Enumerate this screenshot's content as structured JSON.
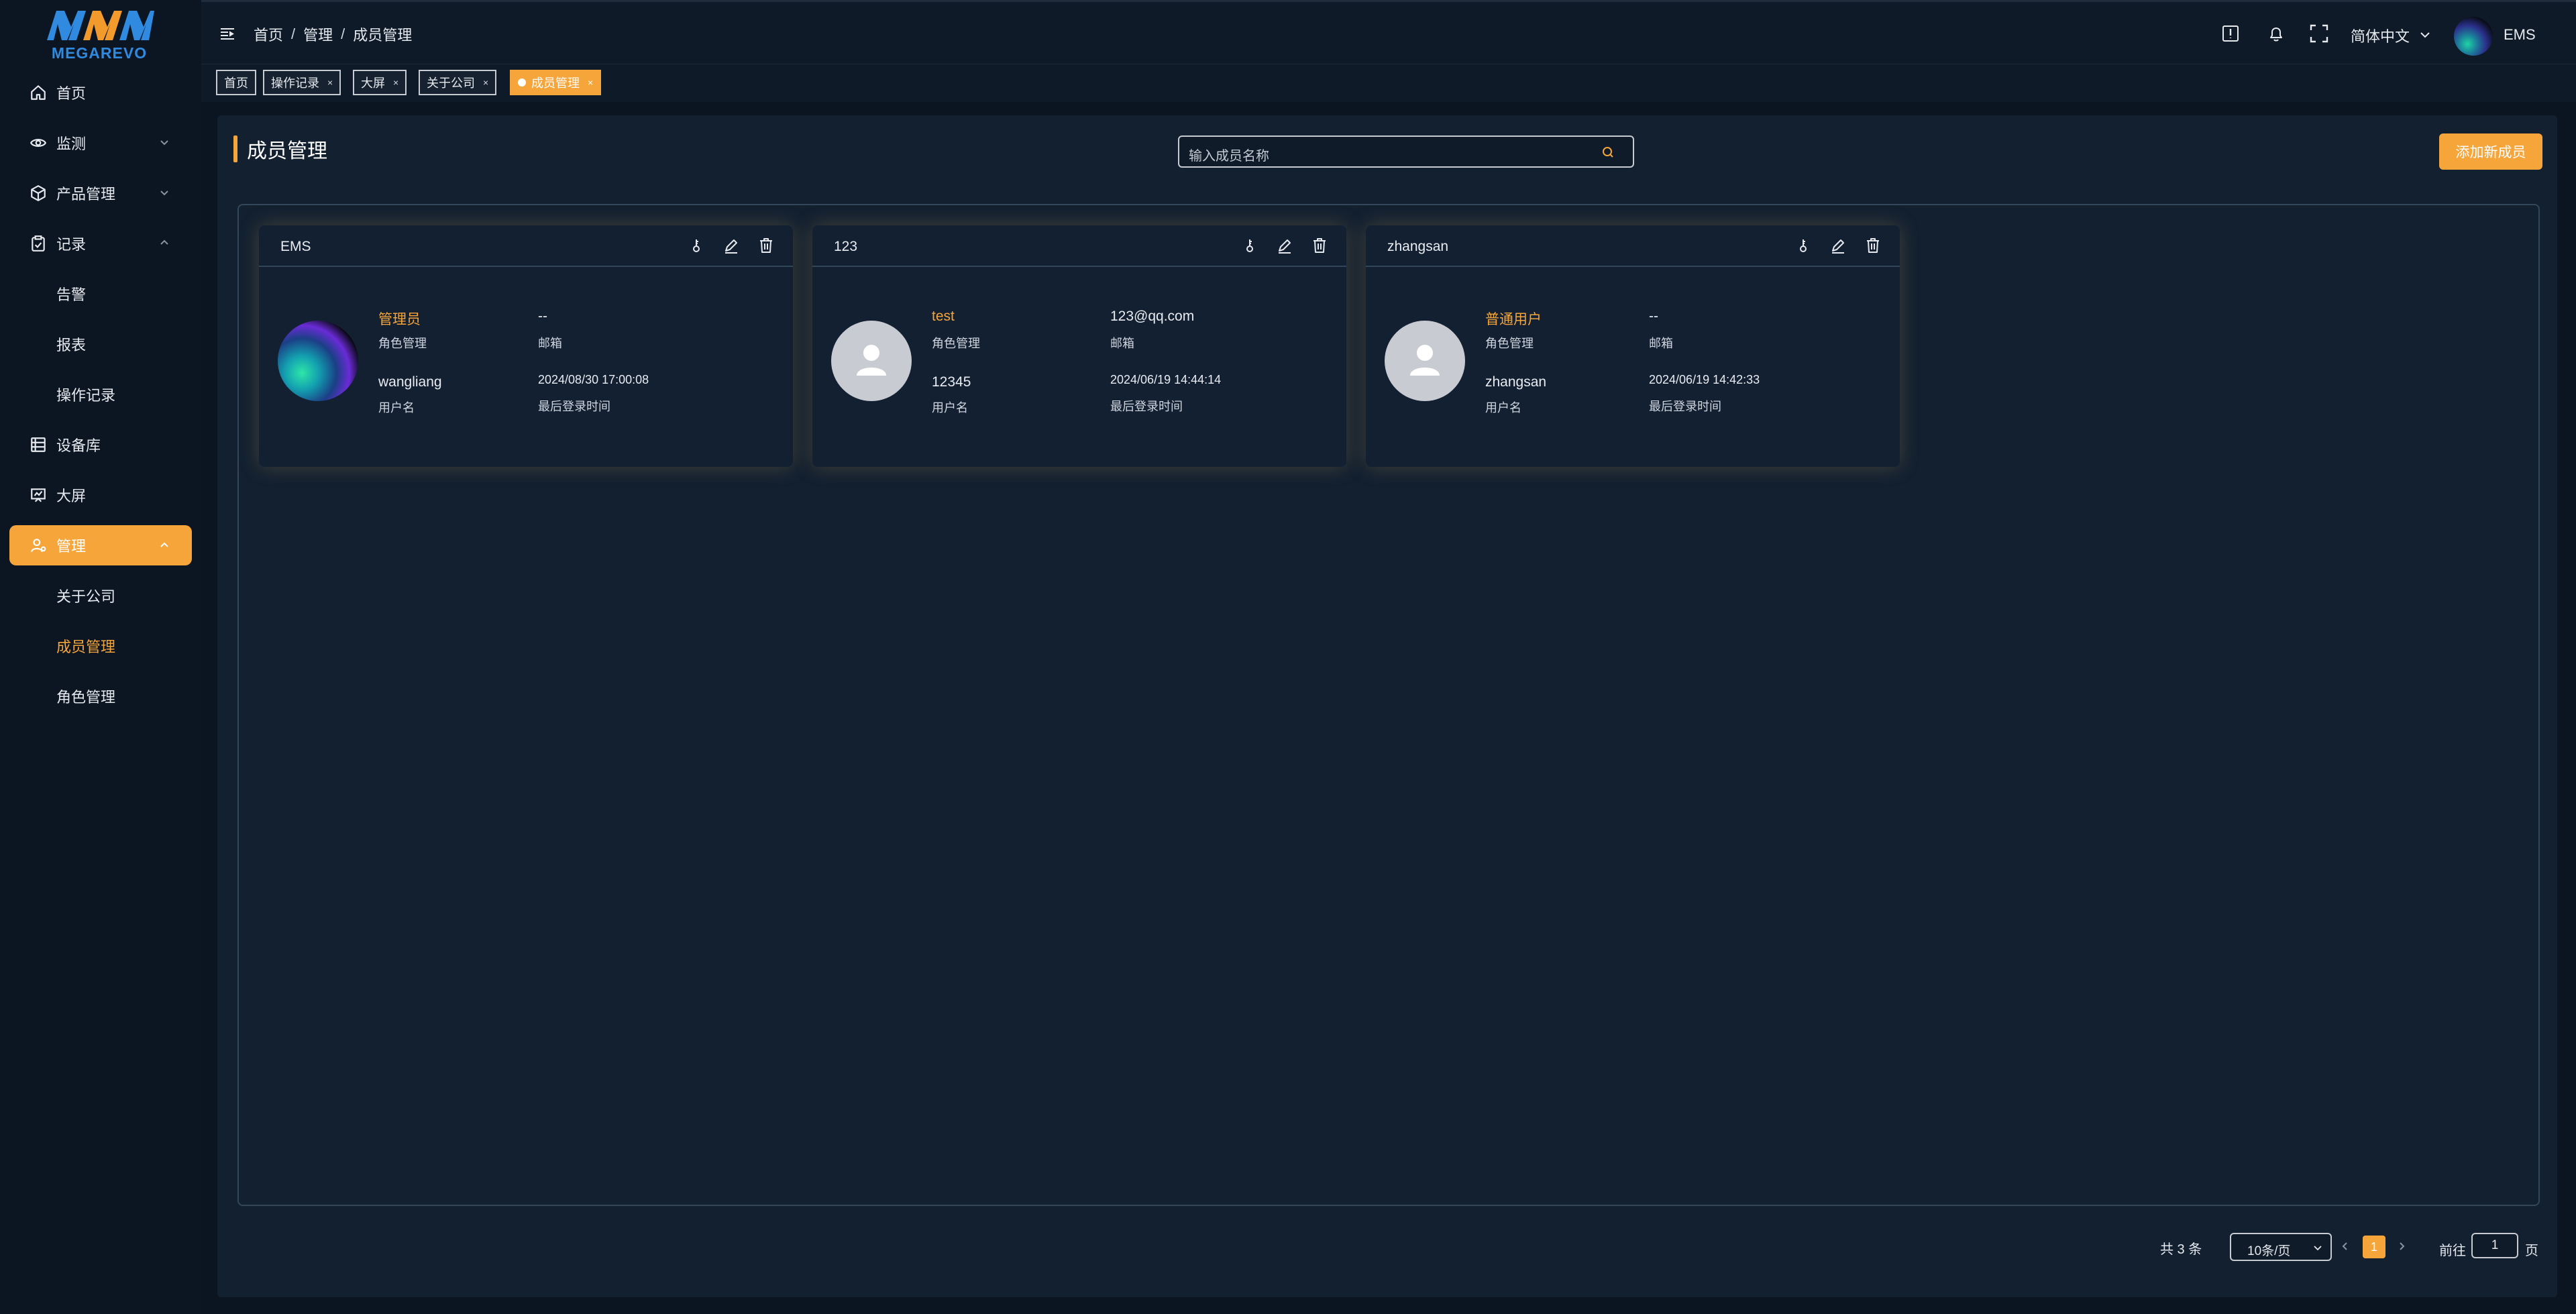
{
  "brand": {
    "logo_text": "MEGAREVO",
    "accent_color": "#f6a53a"
  },
  "sidebar": {
    "items": [
      {
        "label": "首页",
        "icon": "home-icon"
      },
      {
        "label": "监测",
        "icon": "eye-icon"
      },
      {
        "label": "产品管理",
        "icon": "box-icon"
      },
      {
        "label": "记录",
        "icon": "clipboard-icon"
      },
      {
        "label": "告警"
      },
      {
        "label": "报表"
      },
      {
        "label": "操作记录"
      },
      {
        "label": "设备库",
        "icon": "database-icon"
      },
      {
        "label": "大屏",
        "icon": "screen-icon"
      },
      {
        "label": "管理",
        "icon": "user-gear-icon"
      },
      {
        "label": "关于公司"
      },
      {
        "label": "成员管理"
      },
      {
        "label": "角色管理"
      }
    ]
  },
  "header": {
    "breadcrumb": [
      "首页",
      "管理",
      "成员管理"
    ],
    "breadcrumb_sep": "/",
    "language": "简体中文",
    "username": "EMS"
  },
  "tabs": [
    {
      "label": "首页"
    },
    {
      "label": "操作记录",
      "close": "×"
    },
    {
      "label": "大屏",
      "close": "×"
    },
    {
      "label": "关于公司",
      "close": "×"
    },
    {
      "label": "成员管理",
      "close": "×",
      "active": true
    }
  ],
  "main": {
    "title": "成员管理",
    "search_placeholder": "输入成员名称",
    "add_button": "添加新成员",
    "field_labels": {
      "role": "角色管理",
      "email": "邮箱",
      "username": "用户名",
      "last_login": "最后登录时间"
    },
    "members": [
      {
        "name": "EMS",
        "role": "管理员",
        "email": "--",
        "username": "wangliang",
        "last_login": "2024/08/30 17:00:08",
        "avatar": "photo"
      },
      {
        "name": "123",
        "role": "test",
        "email": "123@qq.com",
        "username": "12345",
        "last_login": "2024/06/19 14:44:14",
        "avatar": "default"
      },
      {
        "name": "zhangsan",
        "role": "普通用户",
        "email": "--",
        "username": "zhangsan",
        "last_login": "2024/06/19 14:42:33",
        "avatar": "default"
      }
    ]
  },
  "pagination": {
    "total": "共 3 条",
    "page_size": "10条/页",
    "current_page": "1",
    "goto_label": "前往",
    "goto_value": "1",
    "goto_suffix": "页"
  }
}
